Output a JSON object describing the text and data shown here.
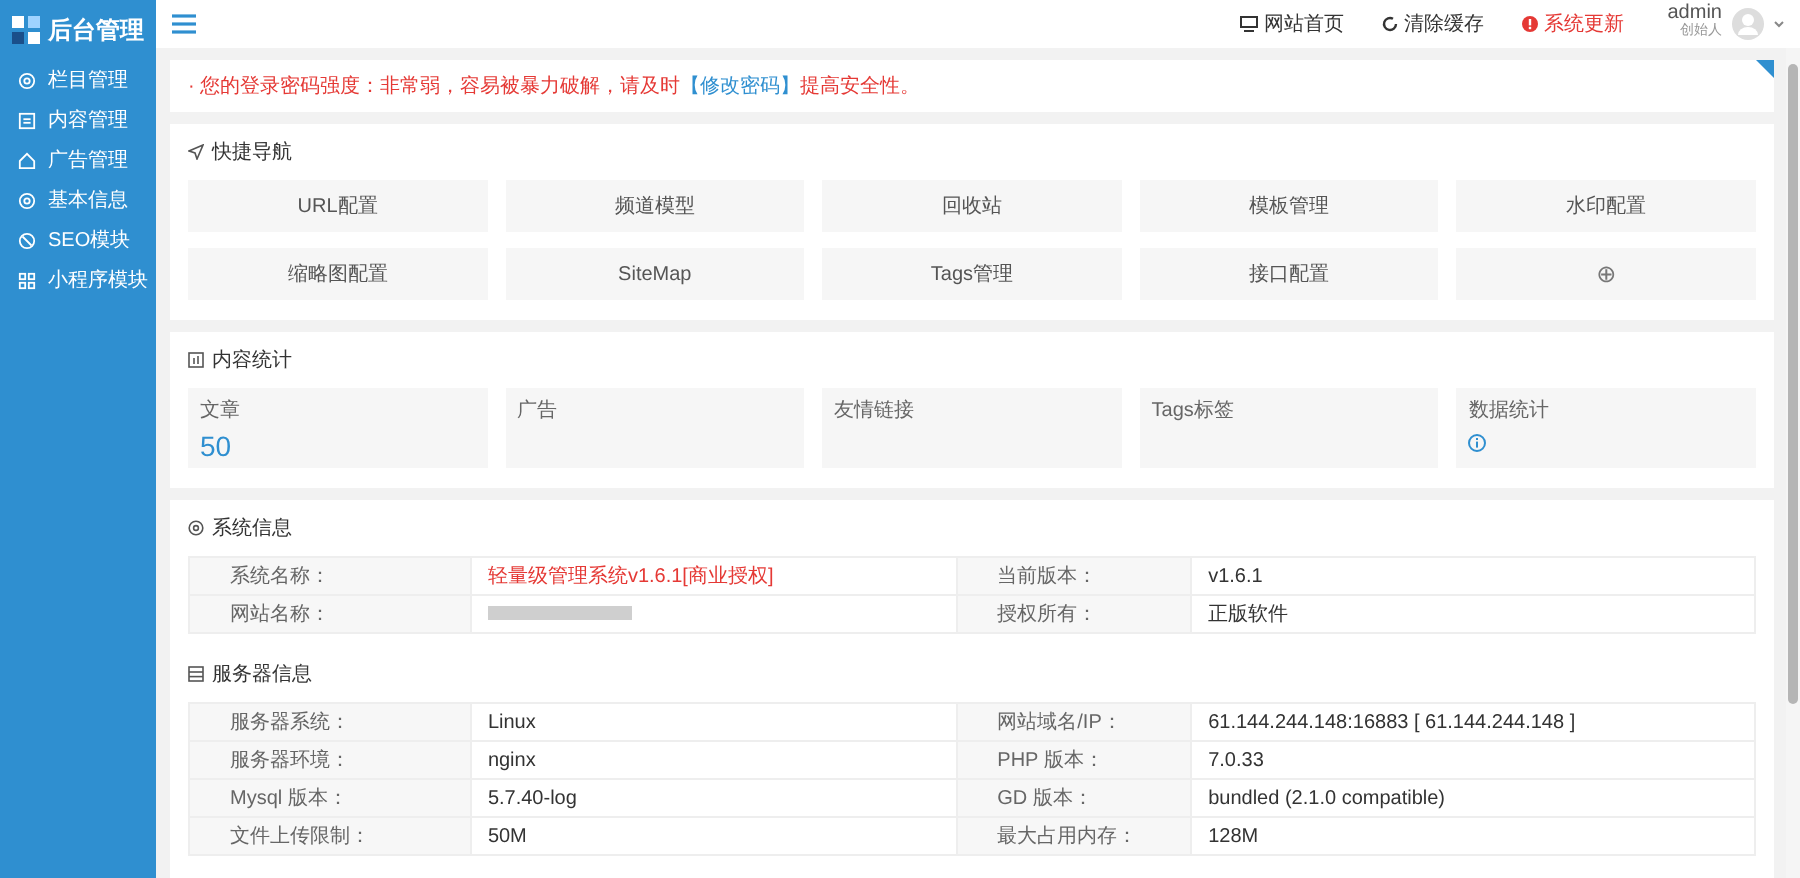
{
  "logo": {
    "text": "后台管理"
  },
  "sidebar": {
    "items": [
      {
        "label": "栏目管理"
      },
      {
        "label": "内容管理"
      },
      {
        "label": "广告管理"
      },
      {
        "label": "基本信息"
      },
      {
        "label": "SEO模块"
      },
      {
        "label": "小程序模块"
      }
    ]
  },
  "topbar": {
    "actions": [
      {
        "label": "网站首页",
        "kind": "home"
      },
      {
        "label": "清除缓存",
        "kind": "refresh"
      },
      {
        "label": "系统更新",
        "kind": "alert"
      }
    ],
    "user": {
      "name": "admin",
      "role": "创始人"
    }
  },
  "notice": {
    "text": "· 您的登录密码强度：非常弱，容易被暴力破解，请及时",
    "link": "【修改密码】",
    "suffix": "提高安全性。"
  },
  "quick_nav": {
    "title": "快捷导航",
    "items": [
      {
        "label": "URL配置",
        "kind": "text"
      },
      {
        "label": "频道模型",
        "kind": "text"
      },
      {
        "label": "回收站",
        "kind": "text"
      },
      {
        "label": "模板管理",
        "kind": "text"
      },
      {
        "label": "水印配置",
        "kind": "text"
      },
      {
        "label": "缩略图配置",
        "kind": "text"
      },
      {
        "label": "SiteMap",
        "kind": "text"
      },
      {
        "label": "Tags管理",
        "kind": "text"
      },
      {
        "label": "接口配置",
        "kind": "text"
      },
      {
        "label": "⊕",
        "kind": "add"
      }
    ]
  },
  "stats": {
    "title": "内容统计",
    "items": [
      {
        "label": "文章",
        "value": "50",
        "kind": "number"
      },
      {
        "label": "广告",
        "kind": "number"
      },
      {
        "label": "友情链接",
        "kind": "number"
      },
      {
        "label": "Tags标签",
        "kind": "number"
      },
      {
        "label": "数据统计",
        "kind": "info"
      }
    ]
  },
  "system": {
    "title": "系统信息",
    "rows": [
      [
        {
          "text": "系统名称：",
          "kind": "label"
        },
        {
          "text": "轻量级管理系统v1.6.1[商业授权]",
          "kind": "alert"
        },
        {
          "text": "当前版本：",
          "kind": "label"
        },
        {
          "text": "v1.6.1",
          "kind": "value"
        }
      ],
      [
        {
          "text": "网站名称：",
          "kind": "label"
        },
        {
          "kind": "blurred"
        },
        {
          "text": "授权所有：",
          "kind": "label"
        },
        {
          "text": "正版软件",
          "kind": "value"
        }
      ]
    ]
  },
  "server": {
    "title": "服务器信息",
    "rows": [
      [
        {
          "text": "服务器系统：",
          "kind": "label"
        },
        {
          "text": "Linux",
          "kind": "value"
        },
        {
          "text": "网站域名/IP：",
          "kind": "label"
        },
        {
          "text": "61.144.244.148:16883 [ 61.144.244.148 ]",
          "kind": "value"
        }
      ],
      [
        {
          "text": "服务器环境：",
          "kind": "label"
        },
        {
          "text": "nginx",
          "kind": "value"
        },
        {
          "text": "PHP 版本：",
          "kind": "label"
        },
        {
          "text": "7.0.33",
          "kind": "value"
        }
      ],
      [
        {
          "text": "Mysql 版本：",
          "kind": "label"
        },
        {
          "text": "5.7.40-log",
          "kind": "value"
        },
        {
          "text": "GD 版本：",
          "kind": "label"
        },
        {
          "text": "bundled (2.1.0 compatible)",
          "kind": "value"
        }
      ],
      [
        {
          "text": "文件上传限制：",
          "kind": "label"
        },
        {
          "text": "50M",
          "kind": "value"
        },
        {
          "text": "最大占用内存：",
          "kind": "label"
        },
        {
          "text": "128M",
          "kind": "value"
        }
      ]
    ]
  }
}
